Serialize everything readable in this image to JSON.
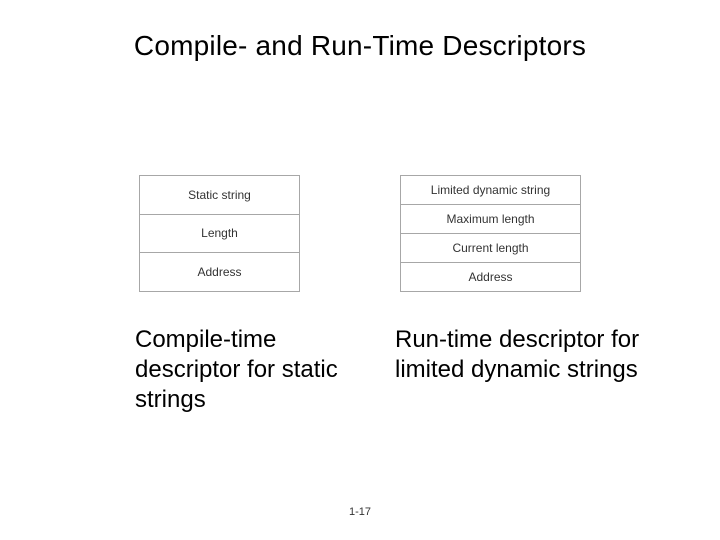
{
  "title": "Compile- and Run-Time Descriptors",
  "left_box": {
    "rows": [
      "Static string",
      "Length",
      "Address"
    ]
  },
  "right_box": {
    "rows": [
      "Limited dynamic string",
      "Maximum length",
      "Current length",
      "Address"
    ]
  },
  "captions": {
    "left": "Compile-time descriptor for static strings",
    "right": "Run-time descriptor for limited dynamic strings"
  },
  "page_number": "1-17"
}
